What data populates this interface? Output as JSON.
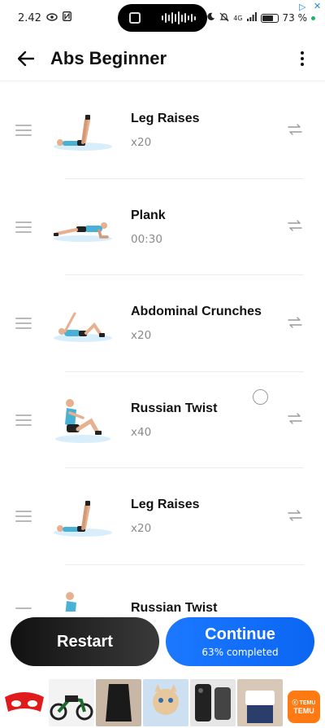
{
  "status_bar": {
    "time": "2.42",
    "network": "4G",
    "battery": "73 %",
    "battery_level": 0.73
  },
  "header": {
    "title": "Abs Beginner"
  },
  "exercises": [
    {
      "name": "Leg Raises",
      "value": "x20",
      "icon": "leg-raises-figure"
    },
    {
      "name": "Plank",
      "value": "00:30",
      "icon": "plank-figure"
    },
    {
      "name": "Abdominal Crunches",
      "value": "x20",
      "icon": "crunch-figure"
    },
    {
      "name": "Russian Twist",
      "value": "x40",
      "icon": "russian-twist-figure"
    },
    {
      "name": "Leg Raises",
      "value": "x20",
      "icon": "leg-raises-figure"
    },
    {
      "name": "Russian Twist",
      "value": "",
      "icon": "russian-twist-figure"
    }
  ],
  "actions": {
    "restart_label": "Restart",
    "continue_label": "Continue",
    "progress_label": "63% completed",
    "progress": 0.63
  },
  "ad": {
    "brand": "TEMU",
    "brand_script": "ⓒ TEMU"
  },
  "colors": {
    "accent": "#0b66f2",
    "dark_button": "#111111",
    "ad_brand": "#ff7a13"
  }
}
